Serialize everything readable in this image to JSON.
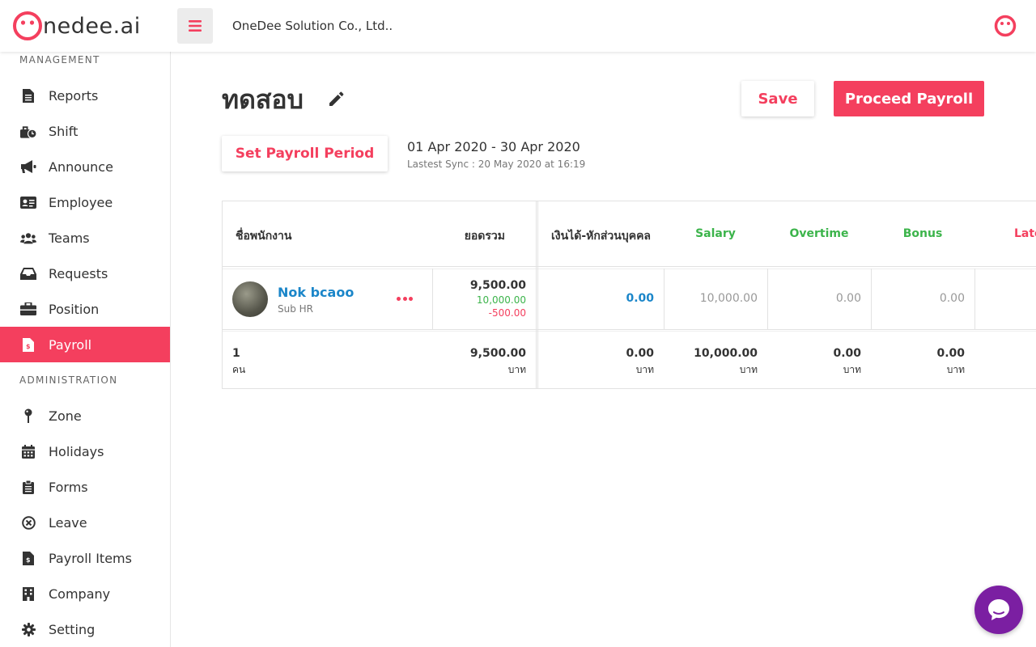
{
  "header": {
    "logo_text": "nedee.ai",
    "company": "OneDee Solution Co., Ltd.."
  },
  "sidebar": {
    "management_title": "MANAGEMENT",
    "administration_title": "ADMINISTRATION",
    "items": [
      {
        "label": "Reports",
        "icon": "file-icon"
      },
      {
        "label": "Shift",
        "icon": "shift-icon"
      },
      {
        "label": "Announce",
        "icon": "megaphone-icon"
      },
      {
        "label": "Employee",
        "icon": "id-card-icon"
      },
      {
        "label": "Teams",
        "icon": "users-icon"
      },
      {
        "label": "Requests",
        "icon": "inbox-icon"
      },
      {
        "label": "Position",
        "icon": "briefcase-icon"
      },
      {
        "label": "Payroll",
        "icon": "file-invoice-icon",
        "active": true
      }
    ],
    "admin_items": [
      {
        "label": "Zone",
        "icon": "map-pin-icon"
      },
      {
        "label": "Holidays",
        "icon": "calendar-icon"
      },
      {
        "label": "Forms",
        "icon": "clipboard-icon"
      },
      {
        "label": "Leave",
        "icon": "circle-x-icon"
      },
      {
        "label": "Payroll Items",
        "icon": "file-invoice-icon"
      },
      {
        "label": "Company",
        "icon": "building-icon"
      },
      {
        "label": "Setting",
        "icon": "gear-icon"
      }
    ]
  },
  "main": {
    "title": "ทดสอบ",
    "save_label": "Save",
    "proceed_label": "Proceed Payroll",
    "set_period_label": "Set Payroll Period",
    "period_range": "01 Apr 2020 - 30 Apr 2020",
    "last_sync": "Lastest Sync : 20 May 2020 at 16:19"
  },
  "table": {
    "headers": {
      "employee": "ชื่อพนักงาน",
      "total": "ยอดรวม",
      "personal": "เงินได้-หักส่วนบุคคล",
      "salary": "Salary",
      "overtime": "Overtime",
      "bonus": "Bonus",
      "late": "Late"
    },
    "row": {
      "name": "Nok bcaoo",
      "role": "Sub HR",
      "total": "9,500.00",
      "total_plus": "10,000.00",
      "total_minus": "-500.00",
      "personal": "0.00",
      "salary": "10,000.00",
      "overtime": "0.00",
      "bonus": "0.00"
    },
    "summary": {
      "count": "1",
      "count_unit": "คน",
      "total": "9,500.00",
      "personal": "0.00",
      "salary": "10,000.00",
      "overtime": "0.00",
      "bonus": "0.00",
      "unit": "บาท"
    }
  },
  "colors": {
    "accent": "#f43f5e",
    "green": "#3cb44b",
    "blue": "#1b86c9",
    "chat": "#7b1fa2"
  }
}
